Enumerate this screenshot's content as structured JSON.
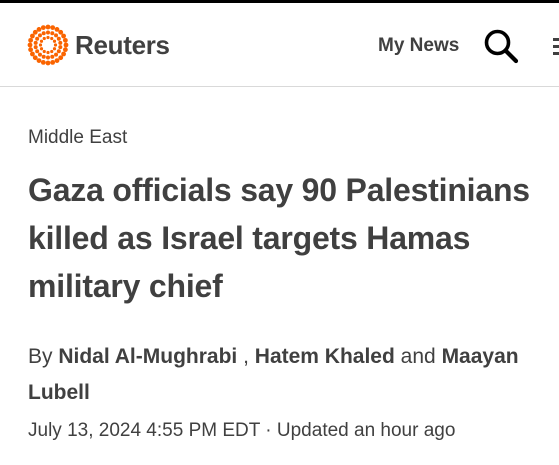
{
  "header": {
    "logo_text": "Reuters",
    "my_news_label": "My News",
    "search_icon": "search-icon",
    "menu_icon": "menu-icon",
    "brand_color": "#fa6400"
  },
  "article": {
    "section": "Middle East",
    "headline": "Gaza officials say 90 Palestinians killed as Israel targets Hamas military chief",
    "byline": {
      "prefix": "By",
      "author_1": "Nidal Al-Mughrabi",
      "separator": ",",
      "author_2": "Hatem Khaled",
      "conjunction": "and",
      "author_3": "Maayan Lubell"
    },
    "date": "July 13, 2024 4:55 PM EDT",
    "date_separator": "·",
    "updated": "Updated an hour ago"
  }
}
